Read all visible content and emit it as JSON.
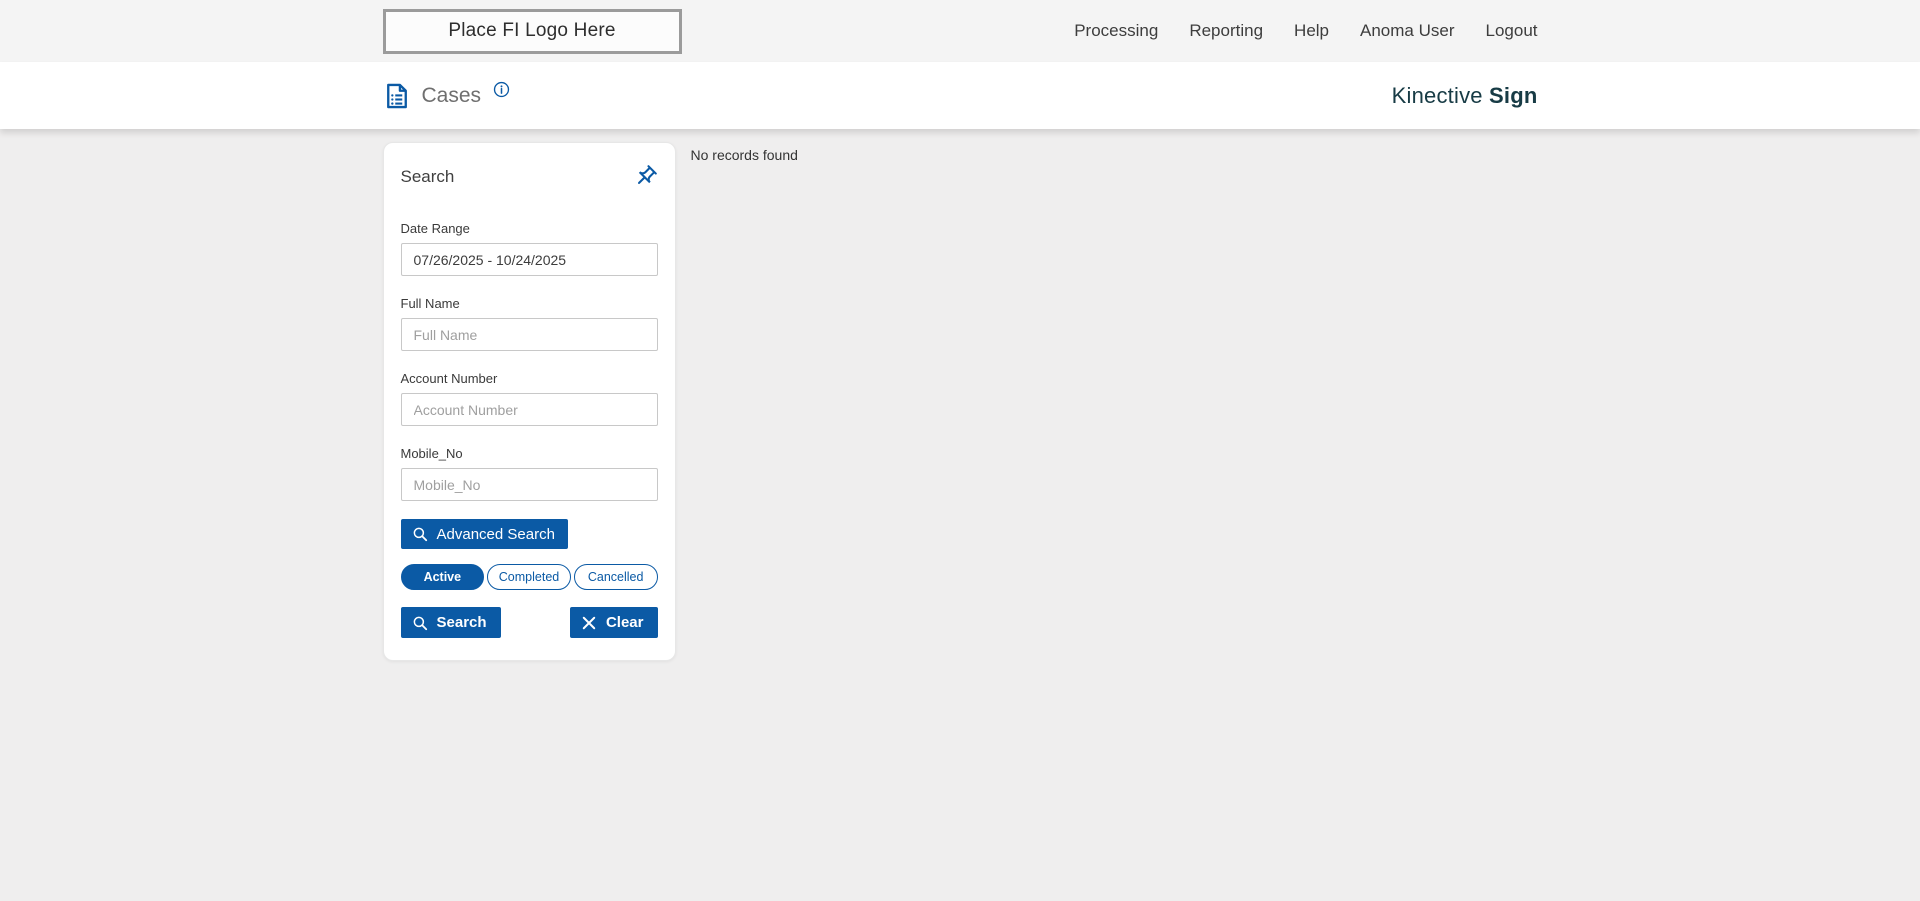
{
  "colors": {
    "primary_blue": "#0b5aa5",
    "brand_text": "#173b45",
    "topbar_background": "#f4f4f4",
    "page_background": "#efeeee"
  },
  "topbar": {
    "logo_placeholder": "Place FI Logo Here",
    "nav_items": [
      {
        "label": "Processing"
      },
      {
        "label": "Reporting"
      },
      {
        "label": "Help"
      },
      {
        "label": "Anoma User"
      },
      {
        "label": "Logout"
      }
    ]
  },
  "header": {
    "page_title": "Cases",
    "brand_name": "Kinective",
    "brand_suffix": "Sign"
  },
  "search_panel": {
    "title": "Search",
    "fields": {
      "date_range": {
        "label": "Date Range",
        "value": "07/26/2025 - 10/24/2025"
      },
      "full_name": {
        "label": "Full Name",
        "placeholder": "Full Name"
      },
      "account_number": {
        "label": "Account Number",
        "placeholder": "Account Number"
      },
      "mobile_no": {
        "label": "Mobile_No",
        "placeholder": "Mobile_No"
      }
    },
    "advanced_search_label": "Advanced Search",
    "status_filters": [
      {
        "label": "Active",
        "selected": true
      },
      {
        "label": "Completed",
        "selected": false
      },
      {
        "label": "Cancelled",
        "selected": false
      }
    ],
    "search_label": "Search",
    "clear_label": "Clear"
  },
  "results": {
    "empty_message": "No records found"
  }
}
